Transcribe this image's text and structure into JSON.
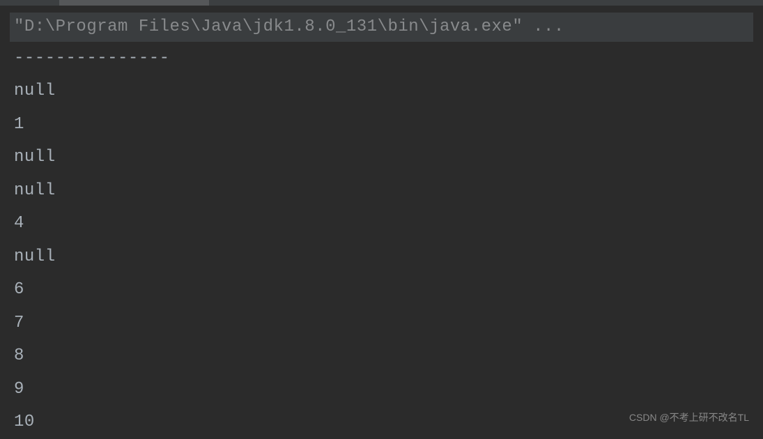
{
  "console": {
    "command": "\"D:\\Program Files\\Java\\jdk1.8.0_131\\bin\\java.exe\" ...",
    "output": [
      "---------------",
      "null",
      "1",
      "null",
      "null",
      "4",
      "null",
      "6",
      "7",
      "8",
      "9",
      "10"
    ]
  },
  "watermark": "CSDN @不考上研不改名TL"
}
